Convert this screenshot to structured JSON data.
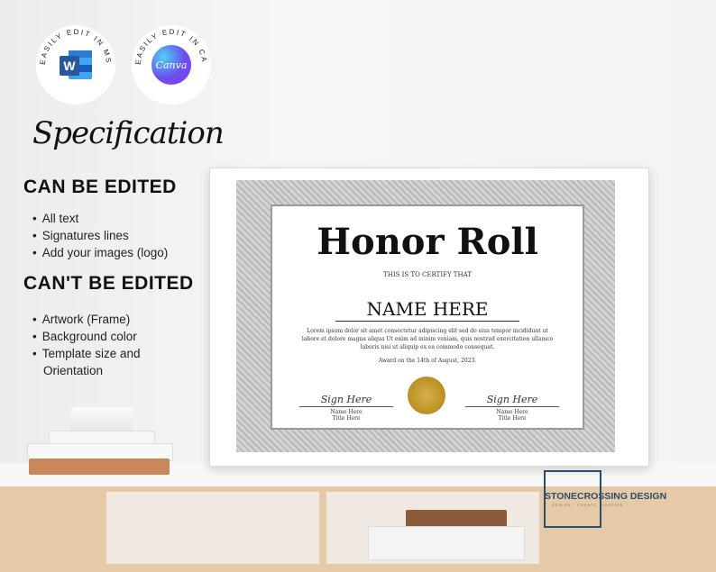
{
  "badges": {
    "word": {
      "arc_text": "EASILY EDIT IN MS WORD",
      "icon_letter": "W"
    },
    "canva": {
      "arc_text": "EASILY EDIT IN CANVA",
      "logo_text": "Canva"
    }
  },
  "spec_title": "Specification",
  "can_edit": {
    "heading": "CAN BE EDITED",
    "items": [
      "All text",
      "Signatures lines",
      "Add your images (logo)"
    ]
  },
  "cant_edit": {
    "heading": "CAN'T BE EDITED",
    "items": [
      "Artwork (Frame)",
      "Background color",
      "Template size and"
    ],
    "continuation": "Orientation"
  },
  "certificate": {
    "title": "Honor Roll",
    "certify": "THIS IS TO CERTIFY THAT",
    "name": "NAME HERE",
    "body_line1": "Lorem ipsum dolor sit amet consectetur adipiscing elit sed do eius tempor incididunt ut",
    "body_line2": "labore et dolore magna aliqua Ut enim ad minim veniam, quis nostrud exercitation ullamco",
    "body_line3": "laboris nisi ut aliquip ex ea commodo consequat.",
    "award": "Award on the 14th of August, 2023.",
    "sig_left": {
      "script": "Sign Here",
      "name": "Name Here",
      "title": "Title Here"
    },
    "sig_right": {
      "script": "Sign Here",
      "name": "Name Here",
      "title": "Title Here"
    }
  },
  "brand": {
    "name": "STONECROSSING DESIGN",
    "tagline": "DESIGN · CREATE · INSPIRE"
  },
  "colors": {
    "word_blue": "#2b579a",
    "brand_blue": "#2a4f6e",
    "seal_gold": "#c9a23a"
  }
}
